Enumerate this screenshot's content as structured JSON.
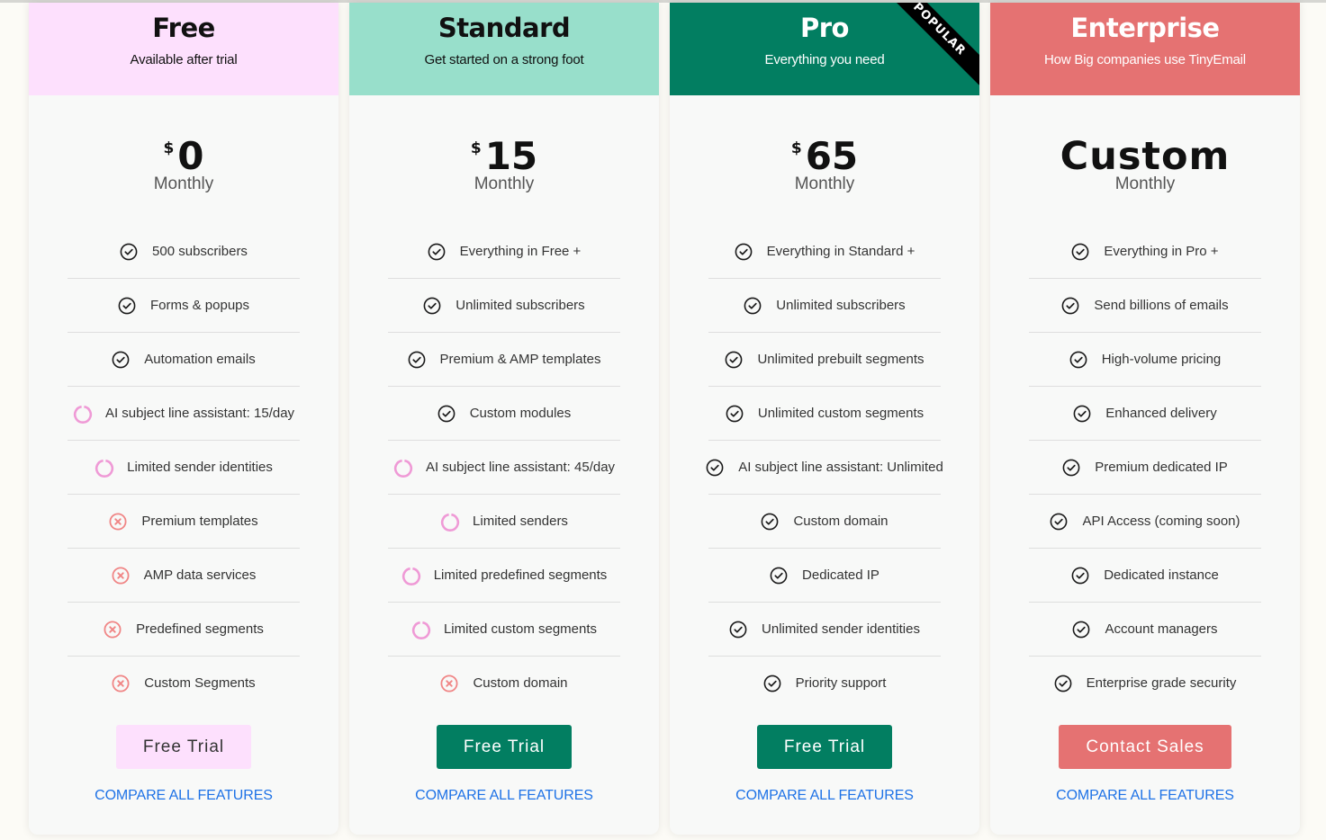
{
  "plans": [
    {
      "name": "Free",
      "tagline": "Available after trial",
      "currency": "$",
      "price": "0",
      "period": "Monthly",
      "header_bg": "#fde0fd",
      "header_fg": "#111111",
      "features": [
        {
          "label": "500 subscribers",
          "status": "included"
        },
        {
          "label": "Forms & popups",
          "status": "included"
        },
        {
          "label": "Automation emails",
          "status": "included"
        },
        {
          "label": "AI subject line assistant: 15/day",
          "status": "limited"
        },
        {
          "label": "Limited sender identities",
          "status": "limited"
        },
        {
          "label": "Premium templates",
          "status": "excluded"
        },
        {
          "label": "AMP data services",
          "status": "excluded"
        },
        {
          "label": "Predefined segments",
          "status": "excluded"
        },
        {
          "label": "Custom Segments",
          "status": "excluded"
        }
      ],
      "cta_label": "Free Trial",
      "cta_bg": "#fde0fd",
      "cta_fg": "#333333",
      "compare_label": "COMPARE ALL FEATURES"
    },
    {
      "name": "Standard",
      "tagline": "Get started on a strong foot",
      "currency": "$",
      "price": "15",
      "period": "Monthly",
      "header_bg": "#98dfcb",
      "header_fg": "#111111",
      "features": [
        {
          "label": "Everything in Free +",
          "status": "included"
        },
        {
          "label": "Unlimited subscribers",
          "status": "included"
        },
        {
          "label": "Premium & AMP templates",
          "status": "included"
        },
        {
          "label": "Custom modules",
          "status": "included"
        },
        {
          "label": "AI subject line assistant: 45/day",
          "status": "limited"
        },
        {
          "label": "Limited senders",
          "status": "limited"
        },
        {
          "label": "Limited predefined segments",
          "status": "limited"
        },
        {
          "label": "Limited custom segments",
          "status": "limited"
        },
        {
          "label": "Custom domain",
          "status": "excluded"
        }
      ],
      "cta_label": "Free Trial",
      "cta_bg": "#027e61",
      "cta_fg": "#ffffff",
      "compare_label": "COMPARE ALL FEATURES"
    },
    {
      "name": "Pro",
      "tagline": "Everything you need",
      "badge": "POPULAR",
      "currency": "$",
      "price": "65",
      "period": "Monthly",
      "header_bg": "#027e61",
      "header_fg": "#ffffff",
      "features": [
        {
          "label": "Everything in Standard +",
          "status": "included"
        },
        {
          "label": "Unlimited subscribers",
          "status": "included"
        },
        {
          "label": "Unlimited prebuilt segments",
          "status": "included"
        },
        {
          "label": "Unlimited custom segments",
          "status": "included"
        },
        {
          "label": "AI subject line assistant: Unlimited",
          "status": "included"
        },
        {
          "label": "Custom domain",
          "status": "included"
        },
        {
          "label": "Dedicated IP",
          "status": "included"
        },
        {
          "label": "Unlimited sender identities",
          "status": "included"
        },
        {
          "label": "Priority support",
          "status": "included"
        }
      ],
      "cta_label": "Free Trial",
      "cta_bg": "#027e61",
      "cta_fg": "#ffffff",
      "compare_label": "COMPARE ALL FEATURES"
    },
    {
      "name": "Enterprise",
      "tagline": "How Big companies use TinyEmail",
      "price": "Custom",
      "period": "Monthly",
      "header_bg": "#e57272",
      "header_fg": "#ffffff",
      "features": [
        {
          "label": "Everything in Pro +",
          "status": "included"
        },
        {
          "label": "Send billions of emails",
          "status": "included"
        },
        {
          "label": "High-volume pricing",
          "status": "included"
        },
        {
          "label": "Enhanced delivery",
          "status": "included"
        },
        {
          "label": "Premium dedicated IP",
          "status": "included"
        },
        {
          "label": "API Access (coming soon)",
          "status": "included"
        },
        {
          "label": "Dedicated instance",
          "status": "included"
        },
        {
          "label": "Account managers",
          "status": "included"
        },
        {
          "label": "Enterprise grade security",
          "status": "included"
        }
      ],
      "cta_label": "Contact Sales",
      "cta_bg": "#e57272",
      "cta_fg": "#ffffff",
      "compare_label": "COMPARE ALL FEATURES"
    }
  ],
  "icons": {
    "included": {
      "name": "check-circle-icon",
      "color": "#1a1a1a"
    },
    "limited": {
      "name": "partial-ring-icon",
      "color": "#ef9ad6"
    },
    "excluded": {
      "name": "x-circle-icon",
      "color": "#f08585"
    }
  },
  "link_color": "#1e72e6"
}
